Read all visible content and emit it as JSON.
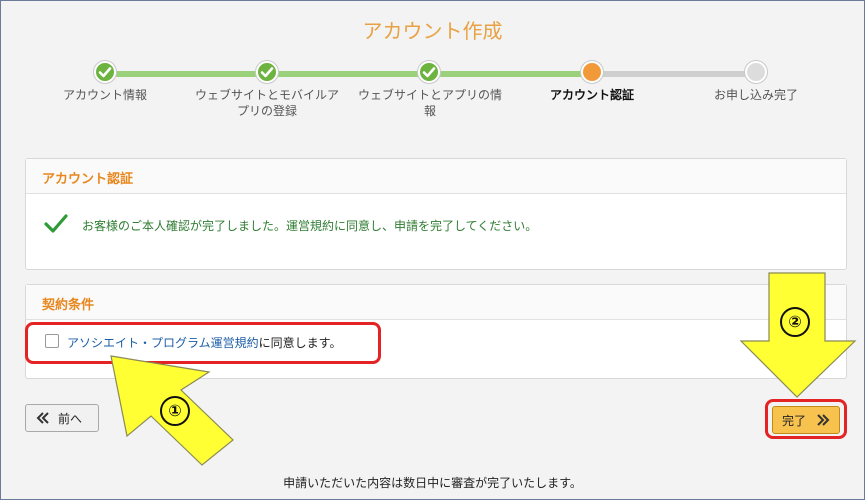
{
  "header": {
    "title": "アカウント作成"
  },
  "steps": [
    {
      "label": "アカウント情報",
      "state": "done"
    },
    {
      "label": "ウェブサイトとモバイルアプリの登録",
      "state": "done"
    },
    {
      "label": "ウェブサイトとアプリの情報",
      "state": "done"
    },
    {
      "label": "アカウント認証",
      "state": "active"
    },
    {
      "label": "お申し込み完了",
      "state": "pending"
    }
  ],
  "verify_panel": {
    "title": "アカウント認証",
    "message": "お客様のご本人確認が完了しました。運営規約に同意し、申請を完了してください。"
  },
  "terms_panel": {
    "title": "契約条件",
    "link_text": "アソシエイト・プログラム運営規約",
    "agree_suffix": "に同意します。"
  },
  "buttons": {
    "prev": "前へ",
    "prev_icon": "double-chevron-left-icon",
    "finish": "完了",
    "finish_icon": "double-chevron-right-icon"
  },
  "footer": {
    "note": "申請いただいた内容は数日中に審査が完了いたします。"
  },
  "annotations": {
    "marker_1": "①",
    "marker_2": "②"
  },
  "colors": {
    "accent_orange": "#e8871e",
    "done_green": "#6cb33f",
    "highlight_red": "#e42424",
    "arrow_yellow": "#ffff33"
  }
}
